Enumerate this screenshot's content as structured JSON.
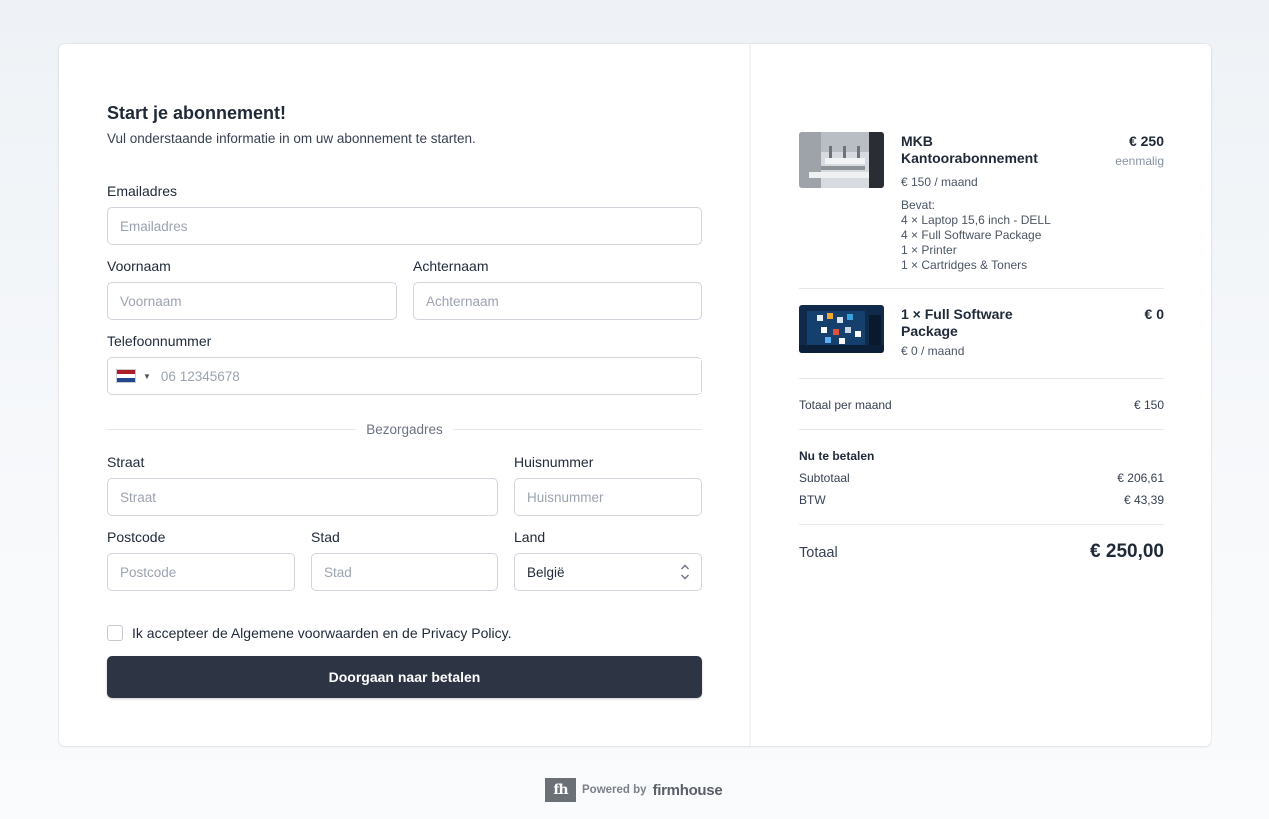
{
  "form": {
    "title": "Start je abonnement!",
    "subtitle": "Vul onderstaande informatie in om uw abonnement te starten.",
    "email": {
      "label": "Emailadres",
      "placeholder": "Emailadres",
      "value": ""
    },
    "first_name": {
      "label": "Voornaam",
      "placeholder": "Voornaam",
      "value": ""
    },
    "last_name": {
      "label": "Achternaam",
      "placeholder": "Achternaam",
      "value": ""
    },
    "phone": {
      "label": "Telefoonnummer",
      "placeholder": "06 12345678",
      "value": "",
      "country_flag": "netherlands-flag-icon"
    },
    "address_section": "Bezorgadres",
    "street": {
      "label": "Straat",
      "placeholder": "Straat",
      "value": ""
    },
    "house_number": {
      "label": "Huisnummer",
      "placeholder": "Huisnummer",
      "value": ""
    },
    "postcode": {
      "label": "Postcode",
      "placeholder": "Postcode",
      "value": ""
    },
    "city": {
      "label": "Stad",
      "placeholder": "Stad",
      "value": ""
    },
    "country": {
      "label": "Land",
      "selected": "België"
    },
    "terms_label": "Ik accepteer de Algemene voorwaarden en de Privacy Policy.",
    "submit_label": "Doorgaan naar betalen"
  },
  "summary": {
    "items": [
      {
        "name": "MKB Kantoorabonnement",
        "price": "€ 250",
        "price_note": "eenmalig",
        "recurring": "€ 150 / maand",
        "contents_title": "Bevat:",
        "contents": [
          "4 × Laptop 15,6 inch - DELL",
          "4 × Full Software Package",
          "1 × Printer",
          "1 × Cartridges & Toners"
        ]
      },
      {
        "name": "1 × Full Software Package",
        "price": "€ 0",
        "recurring": "€ 0 / maand"
      }
    ],
    "monthly_total_label": "Totaal per maand",
    "monthly_total_value": "€ 150",
    "pay_now_label": "Nu te betalen",
    "subtotal_label": "Subtotaal",
    "subtotal_value": "€ 206,61",
    "vat_label": "BTW",
    "vat_value": "€ 43,39",
    "total_label": "Totaal",
    "total_value": "€ 250,00"
  },
  "footer": {
    "logo_text": "fh",
    "powered_by": "Powered by",
    "brand": "firmhouse"
  },
  "colors": {
    "button_bg": "#2d3444",
    "page_bg": "#eef2f6",
    "flag_red": "#ae1c28",
    "flag_white": "#ffffff",
    "flag_blue": "#21468b"
  }
}
